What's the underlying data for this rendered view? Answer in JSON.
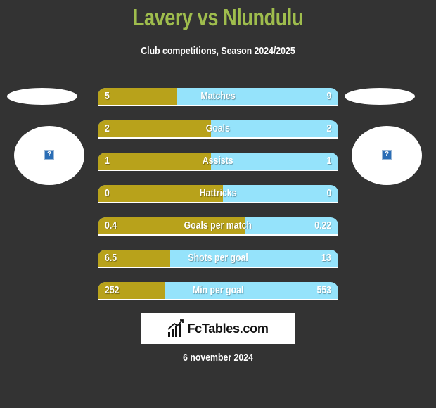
{
  "header": {
    "title": "Lavery vs Nlundulu",
    "subtitle": "Club competitions, Season 2024/2025"
  },
  "players": {
    "left": {
      "avatar_icon": "missing-image-icon",
      "placeholder_glyph": "?"
    },
    "right": {
      "avatar_icon": "missing-image-icon",
      "placeholder_glyph": "?"
    }
  },
  "colors": {
    "title": "#9fbd4d",
    "left_bar": "#b8a21b",
    "right_bar": "#95e3fb",
    "background": "#333333"
  },
  "stats": [
    {
      "label": "Matches",
      "left": "5",
      "right": "9",
      "left_fraction": 0.33
    },
    {
      "label": "Goals",
      "left": "2",
      "right": "2",
      "left_fraction": 0.47
    },
    {
      "label": "Assists",
      "left": "1",
      "right": "1",
      "left_fraction": 0.47
    },
    {
      "label": "Hattricks",
      "left": "0",
      "right": "0",
      "left_fraction": 0.52
    },
    {
      "label": "Goals per match",
      "left": "0.4",
      "right": "0.22",
      "left_fraction": 0.61
    },
    {
      "label": "Shots per goal",
      "left": "6.5",
      "right": "13",
      "left_fraction": 0.3
    },
    {
      "label": "Min per goal",
      "left": "252",
      "right": "553",
      "left_fraction": 0.28
    }
  ],
  "footer": {
    "logo_text": "FcTables.com",
    "logo_icon": "bar-chart-icon",
    "date": "6 november 2024"
  }
}
